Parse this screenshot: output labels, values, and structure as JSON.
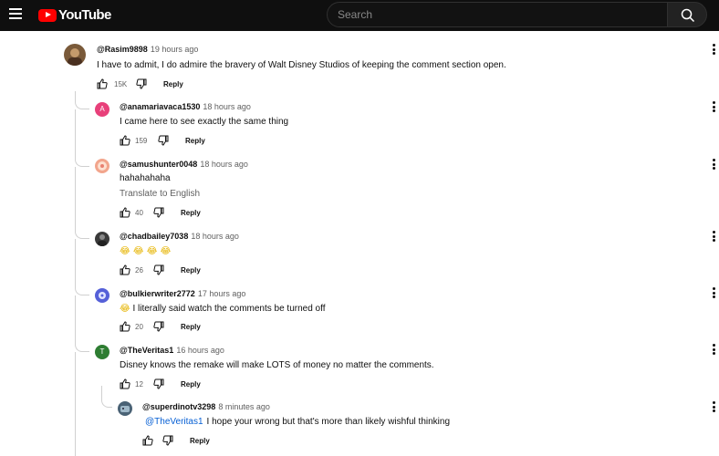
{
  "header": {
    "logo_text": "YouTube",
    "search_placeholder": "Search"
  },
  "comments": [
    {
      "author": "@Rasim9898",
      "time": "19 hours ago",
      "text": "I have to admit, I do admire the bravery of Walt Disney Studios of keeping the comment section open.",
      "likes": "15K",
      "reply_label": "Reply",
      "avatar_color": "#7a5a3a"
    },
    {
      "author": "@anamariavaca1530",
      "time": "18 hours ago",
      "text": "I came here to see exactly the same thing",
      "likes": "159",
      "reply_label": "Reply",
      "avatar_letter": "A",
      "avatar_color": "#e8407a"
    },
    {
      "author": "@samushunter0048",
      "time": "18 hours ago",
      "text": "hahahahaha",
      "translate_label": "Translate to English",
      "likes": "40",
      "reply_label": "Reply",
      "avatar_color": "#f2a58c"
    },
    {
      "author": "@chadbailey7038",
      "time": "18 hours ago",
      "text": "😂 😂 😂 😂",
      "likes": "26",
      "reply_label": "Reply",
      "avatar_color": "#3a3a3a"
    },
    {
      "author": "@bulkierwriter2772",
      "time": "17 hours ago",
      "emoji": "😂",
      "text": "I literally said watch the comments be turned off",
      "likes": "20",
      "reply_label": "Reply",
      "avatar_color": "#5560d8"
    },
    {
      "author": "@TheVeritas1",
      "time": "16 hours ago",
      "text": "Disney knows the remake will make LOTS of money no matter the comments.",
      "likes": "12",
      "reply_label": "Reply",
      "avatar_letter": "T",
      "avatar_color": "#2e7d32"
    },
    {
      "author": "@superdinotv3298",
      "time": "8 minutes ago",
      "mention": "@TheVeritas1",
      "text": "I hope your wrong but that's more than likely wishful thinking",
      "likes": "",
      "reply_label": "Reply",
      "avatar_color": "#4a6275"
    }
  ]
}
